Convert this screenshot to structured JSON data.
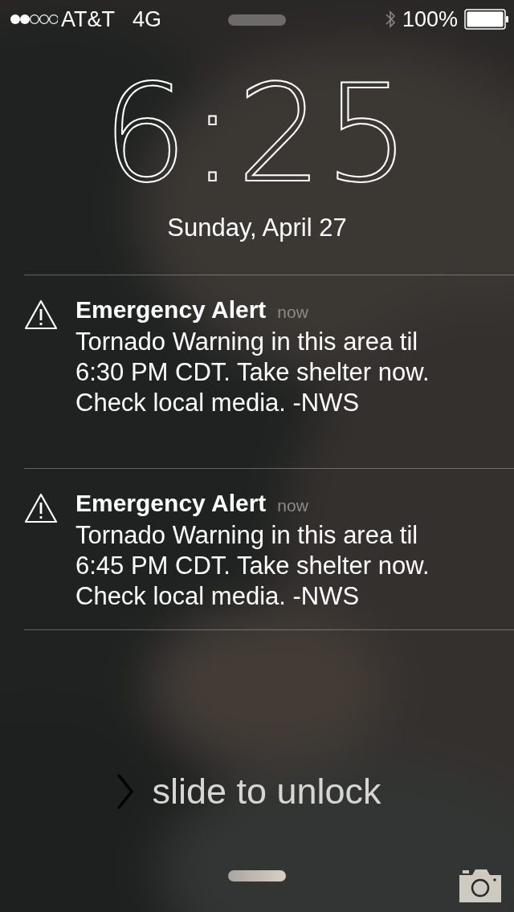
{
  "status_bar": {
    "carrier": "AT&T",
    "network": "4G",
    "battery": "100%"
  },
  "clock": {
    "time": "6:25",
    "date": "Sunday, April 27"
  },
  "notifications": [
    {
      "title": "Emergency Alert",
      "time": "now",
      "body": "Tornado Warning in this area til 6:30 PM CDT. Take shelter now. Check local media. -NWS"
    },
    {
      "title": "Emergency Alert",
      "time": "now",
      "body": "Tornado Warning in this area til 6:45 PM CDT. Take shelter now. Check local media. -NWS"
    }
  ],
  "unlock": {
    "label": "slide to unlock"
  }
}
